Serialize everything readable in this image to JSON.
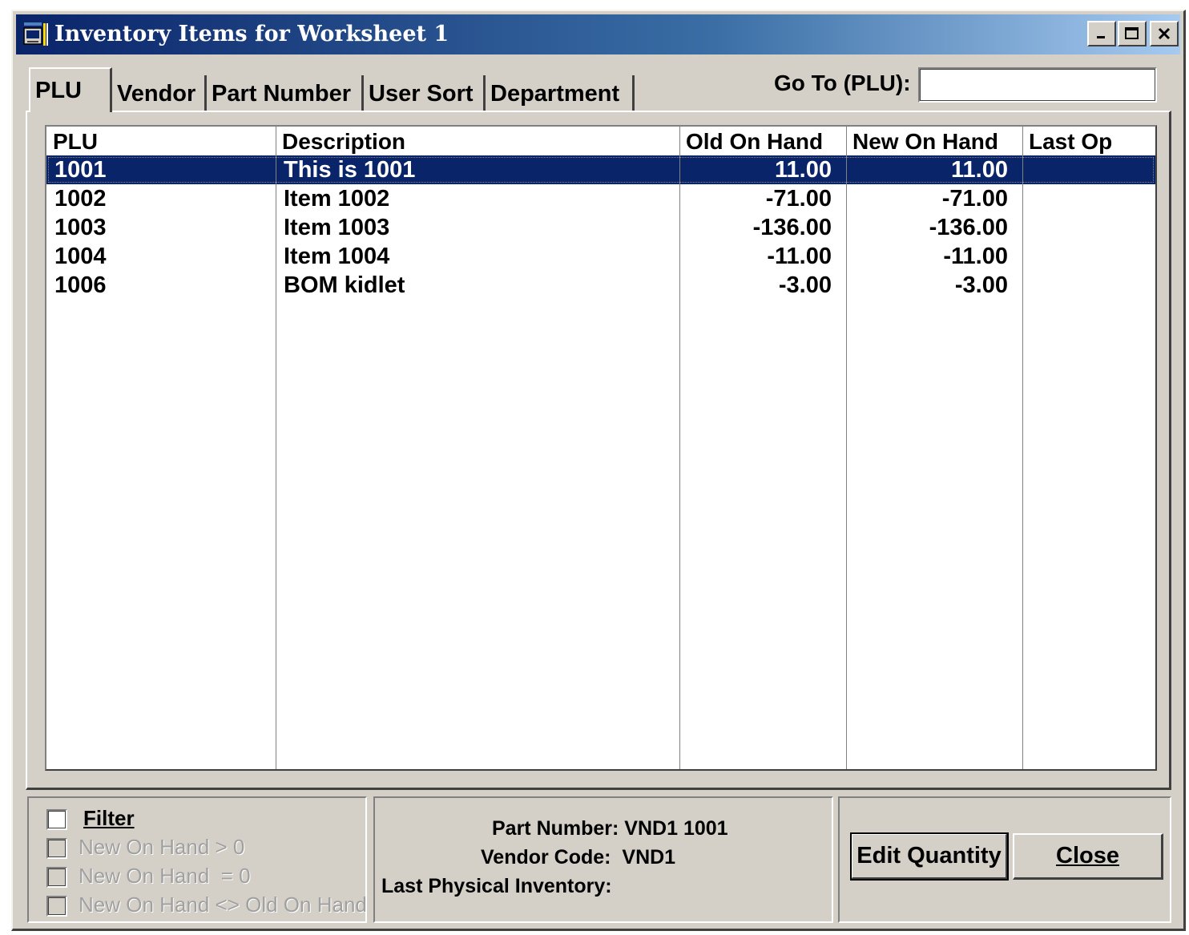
{
  "window": {
    "title": "Inventory Items for Worksheet 1"
  },
  "tabs": [
    {
      "label": "PLU",
      "active": true
    },
    {
      "label": "Vendor"
    },
    {
      "label": "Part Number"
    },
    {
      "label": "User Sort"
    },
    {
      "label": "Department"
    }
  ],
  "goto": {
    "label": "Go To (PLU):",
    "value": ""
  },
  "table": {
    "columns": [
      "PLU",
      "Description",
      "Old On Hand",
      "New On Hand",
      "Last Op"
    ],
    "rows": [
      {
        "plu": "1001",
        "description": "This is 1001",
        "old_on_hand": "11.00",
        "new_on_hand": "11.00",
        "last_op": "",
        "selected": true
      },
      {
        "plu": "1002",
        "description": "Item 1002",
        "old_on_hand": "-71.00",
        "new_on_hand": "-71.00",
        "last_op": ""
      },
      {
        "plu": "1003",
        "description": "Item 1003",
        "old_on_hand": "-136.00",
        "new_on_hand": "-136.00",
        "last_op": ""
      },
      {
        "plu": "1004",
        "description": "Item 1004",
        "old_on_hand": "-11.00",
        "new_on_hand": "-11.00",
        "last_op": ""
      },
      {
        "plu": "1006",
        "description": "BOM kidlet",
        "old_on_hand": "-3.00",
        "new_on_hand": "-3.00",
        "last_op": ""
      }
    ]
  },
  "filters": {
    "filter_label": "Filter",
    "options": [
      {
        "label": "New On Hand > 0",
        "enabled": false
      },
      {
        "label": "New On Hand  = 0",
        "enabled": false
      },
      {
        "label": "New On Hand <> Old On Hand",
        "enabled": false
      }
    ]
  },
  "info": {
    "part_number": "Part Number: VND1 1001",
    "vendor_code": "Vendor Code:  VND1",
    "last_physical": "Last Physical Inventory:"
  },
  "buttons": {
    "edit_quantity": "Edit Quantity",
    "close": "Close"
  },
  "colors": {
    "selection": "#0a246a",
    "face": "#d4d0c8",
    "title_gradient_start": "#0a246a",
    "title_gradient_end": "#a6caf0"
  }
}
